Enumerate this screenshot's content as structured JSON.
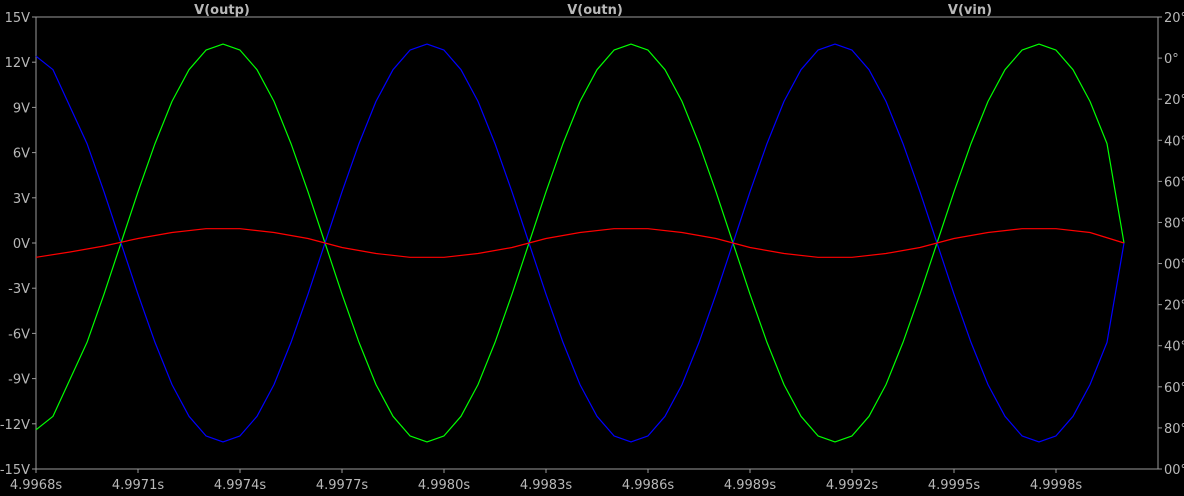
{
  "chart_data": {
    "type": "line",
    "title": "",
    "xlabel": "",
    "ylabel": "",
    "xlim": [
      4.9968,
      5.0001
    ],
    "ylim": [
      -15,
      15
    ],
    "right_axis_tick_labels": [
      "20°",
      "0°",
      "20°",
      "40°",
      "60°",
      "80°",
      "00°",
      "20°",
      "40°",
      "60°",
      "80°",
      "00°"
    ],
    "grid": false,
    "x_tick_labels": [
      "4.9968s",
      "4.9971s",
      "4.9974s",
      "4.9977s",
      "4.9980s",
      "4.9983s",
      "4.9986s",
      "4.9989s",
      "4.9992s",
      "4.9995s",
      "4.9998s"
    ],
    "x_ticks": [
      4.9968,
      4.9971,
      4.9974,
      4.9977,
      4.998,
      4.9983,
      4.9986,
      4.9989,
      4.9992,
      4.9995,
      4.9998
    ],
    "y_tick_labels": [
      "15V",
      "12V",
      "9V",
      "6V",
      "3V",
      "0V",
      "-3V",
      "-6V",
      "-9V",
      "-12V",
      "-15V"
    ],
    "y_ticks": [
      15,
      12,
      9,
      6,
      3,
      0,
      -3,
      -6,
      -9,
      -12,
      -15
    ],
    "colors": {
      "background": "#000000",
      "axes": "#9a9a9a",
      "tick_text": "#b8b8b8"
    },
    "series": [
      {
        "name": "V(outp)",
        "color": "#00ff00",
        "x": [
          4.9968,
          4.99685,
          4.99695,
          4.997,
          4.99705,
          4.9971,
          4.99715,
          4.9972,
          4.99725,
          4.9973,
          4.99735,
          4.9974,
          4.99745,
          4.9975,
          4.99755,
          4.9976,
          4.99765,
          4.9977,
          4.99775,
          4.9978,
          4.99785,
          4.9979,
          4.99795,
          4.998,
          4.99805,
          4.9981,
          4.99815,
          4.9982,
          4.99825,
          4.9983,
          4.99835,
          4.9984,
          4.99845,
          4.9985,
          4.99855,
          4.9986,
          4.99865,
          4.9987,
          4.99875,
          4.9988,
          4.99885,
          4.9989,
          4.99895,
          4.999,
          4.99905,
          4.9991,
          4.99915,
          4.9992,
          4.99925,
          4.9993,
          4.99935,
          4.9994,
          4.99945,
          4.9995,
          4.99955,
          4.9996,
          4.99965,
          4.9997,
          4.99975,
          4.9998,
          4.99985,
          4.9999,
          4.99995,
          5.0
        ],
        "y": [
          -12.4,
          -11.5,
          -6.6,
          -3.4,
          0.0,
          3.4,
          6.6,
          9.4,
          11.5,
          12.8,
          13.2,
          12.8,
          11.5,
          9.4,
          6.6,
          3.4,
          0.0,
          -3.4,
          -6.6,
          -9.4,
          -11.5,
          -12.8,
          -13.2,
          -12.8,
          -11.5,
          -9.4,
          -6.6,
          -3.4,
          0.0,
          3.4,
          6.6,
          9.4,
          11.5,
          12.8,
          13.2,
          12.8,
          11.5,
          9.4,
          6.6,
          3.4,
          0.0,
          -3.4,
          -6.6,
          -9.4,
          -11.5,
          -12.8,
          -13.2,
          -12.8,
          -11.5,
          -9.4,
          -6.6,
          -3.4,
          0.0,
          3.4,
          6.6,
          9.4,
          11.5,
          12.8,
          13.2,
          12.8,
          11.5,
          9.4,
          6.6,
          0.0
        ]
      },
      {
        "name": "V(outn)",
        "color": "#0000ff",
        "x": [
          4.9968,
          4.99685,
          4.99695,
          4.997,
          4.99705,
          4.9971,
          4.99715,
          4.9972,
          4.99725,
          4.9973,
          4.99735,
          4.9974,
          4.99745,
          4.9975,
          4.99755,
          4.9976,
          4.99765,
          4.9977,
          4.99775,
          4.9978,
          4.99785,
          4.9979,
          4.99795,
          4.998,
          4.99805,
          4.9981,
          4.99815,
          4.9982,
          4.99825,
          4.9983,
          4.99835,
          4.9984,
          4.99845,
          4.9985,
          4.99855,
          4.9986,
          4.99865,
          4.9987,
          4.99875,
          4.9988,
          4.99885,
          4.9989,
          4.99895,
          4.999,
          4.99905,
          4.9991,
          4.99915,
          4.9992,
          4.99925,
          4.9993,
          4.99935,
          4.9994,
          4.99945,
          4.9995,
          4.99955,
          4.9996,
          4.99965,
          4.9997,
          4.99975,
          4.9998,
          4.99985,
          4.9999,
          4.99995,
          5.0
        ],
        "y": [
          12.4,
          11.5,
          6.6,
          3.4,
          0.0,
          -3.4,
          -6.6,
          -9.4,
          -11.5,
          -12.8,
          -13.2,
          -12.8,
          -11.5,
          -9.4,
          -6.6,
          -3.4,
          0.0,
          3.4,
          6.6,
          9.4,
          11.5,
          12.8,
          13.2,
          12.8,
          11.5,
          9.4,
          6.6,
          3.4,
          0.0,
          -3.4,
          -6.6,
          -9.4,
          -11.5,
          -12.8,
          -13.2,
          -12.8,
          -11.5,
          -9.4,
          -6.6,
          -3.4,
          0.0,
          3.4,
          6.6,
          9.4,
          11.5,
          12.8,
          13.2,
          12.8,
          11.5,
          9.4,
          6.6,
          3.4,
          0.0,
          -3.4,
          -6.6,
          -9.4,
          -11.5,
          -12.8,
          -13.2,
          -12.8,
          -11.5,
          -9.4,
          -6.6,
          0.0
        ]
      },
      {
        "name": "V(vin)",
        "color": "#ff0000",
        "x": [
          4.9968,
          4.9969,
          4.997,
          4.9971,
          4.9972,
          4.9973,
          4.9974,
          4.9975,
          4.9976,
          4.9977,
          4.9978,
          4.9979,
          4.998,
          4.9981,
          4.9982,
          4.9983,
          4.9984,
          4.9985,
          4.9986,
          4.9987,
          4.9988,
          4.9989,
          4.999,
          4.9991,
          4.9992,
          4.9993,
          4.9994,
          4.9995,
          4.9996,
          4.9997,
          4.9998,
          4.9999,
          5.0
        ],
        "y": [
          -0.95,
          -0.6,
          -0.2,
          0.3,
          0.7,
          0.95,
          0.95,
          0.7,
          0.3,
          -0.3,
          -0.7,
          -0.95,
          -0.95,
          -0.7,
          -0.3,
          0.3,
          0.7,
          0.95,
          0.95,
          0.7,
          0.3,
          -0.3,
          -0.7,
          -0.95,
          -0.95,
          -0.7,
          -0.3,
          0.3,
          0.7,
          0.95,
          0.95,
          0.7,
          0.0
        ]
      }
    ]
  }
}
